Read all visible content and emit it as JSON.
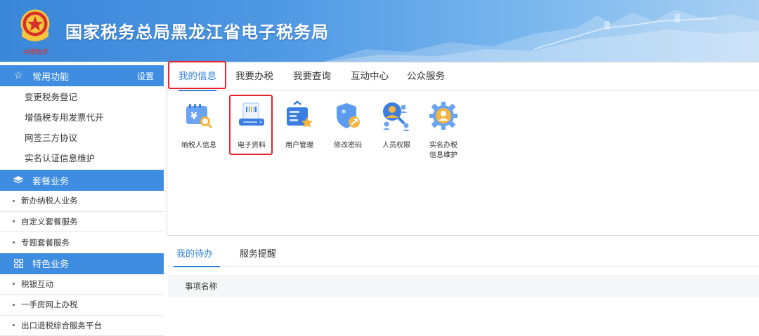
{
  "header": {
    "title": "国家税务总局黑龙江省电子税务局",
    "colors": {
      "from": "#3a86d8",
      "to": "#a9d0f2"
    }
  },
  "sidebar": {
    "common": {
      "title": "常用功能",
      "settings": "设置",
      "icon": "star-icon",
      "items": [
        "变更税务登记",
        "增值税专用发票代开",
        "网签三方协议",
        "实名认证信息维护"
      ]
    },
    "package": {
      "title": "套餐业务",
      "icon": "layers-icon",
      "items": [
        "新办纳税人业务",
        "自定义套餐服务",
        "专题套餐服务"
      ]
    },
    "special": {
      "title": "特色业务",
      "icon": "grid-icon",
      "items": [
        "税银互动",
        "一手房网上办税",
        "出口退税综合服务平台"
      ]
    }
  },
  "tabs": [
    "我的信息",
    "我要办税",
    "我要查询",
    "互动中心",
    "公众服务"
  ],
  "active_tab": "我的信息",
  "apps": [
    {
      "label": "纳税人信息",
      "icon": "taxpayer-info-icon"
    },
    {
      "label": "电子资料",
      "icon": "electronic-documents-icon"
    },
    {
      "label": "用户管理",
      "icon": "user-management-icon"
    },
    {
      "label": "修改密码",
      "icon": "change-password-icon"
    },
    {
      "label": "人员权限",
      "icon": "personnel-permissions-icon"
    },
    {
      "label": "实名办税信息维护",
      "icon": "realname-tax-info-icon"
    }
  ],
  "bottom_tabs": [
    "我的待办",
    "服务提醒"
  ],
  "table": {
    "column": "事项名称"
  },
  "colors": {
    "accent": "#2e7fd8",
    "sidebar_header": "#3f8de0",
    "highlight": "#e8222a"
  }
}
